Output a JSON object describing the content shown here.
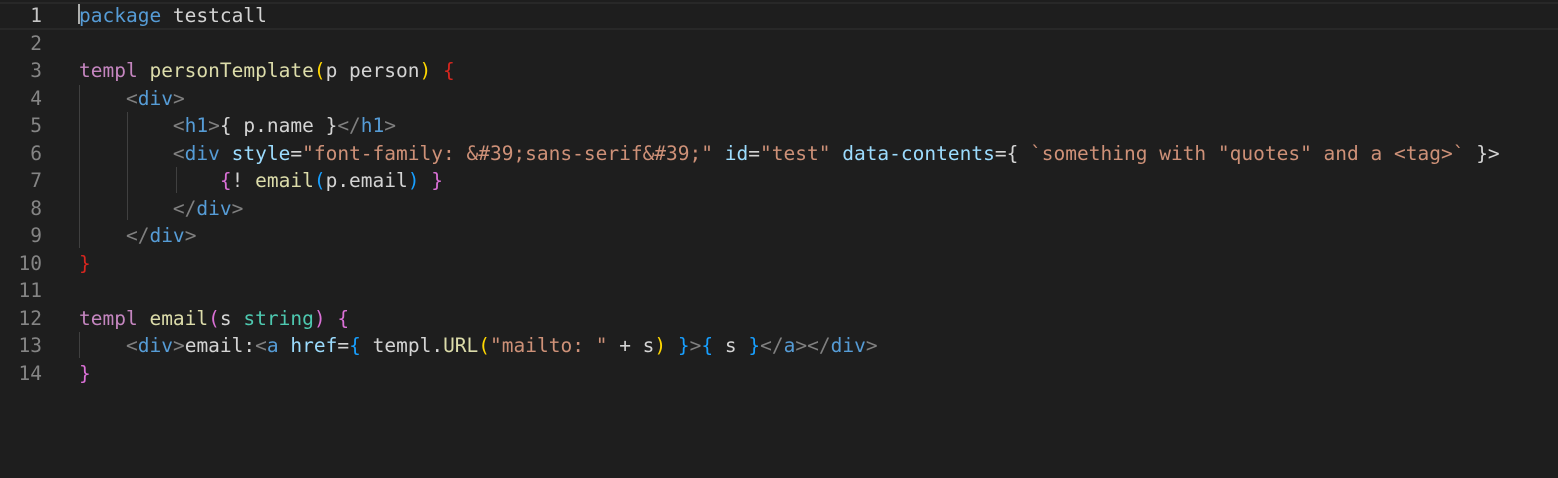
{
  "editor": {
    "line_numbers": [
      "1",
      "2",
      "3",
      "4",
      "5",
      "6",
      "7",
      "8",
      "9",
      "10",
      "11",
      "12",
      "13",
      "14"
    ],
    "lines": [
      [
        {
          "t": "package",
          "c": "kw-blue"
        },
        {
          "t": " testcall",
          "c": "plain"
        }
      ],
      [],
      [
        {
          "t": "templ ",
          "c": "kw-purple"
        },
        {
          "t": "personTemplate",
          "c": "fn"
        },
        {
          "t": "(",
          "c": "b-gold"
        },
        {
          "t": "p person",
          "c": "plain"
        },
        {
          "t": ")",
          "c": "b-gold"
        },
        {
          "t": " ",
          "c": "plain"
        },
        {
          "t": "{",
          "c": "b-red"
        }
      ],
      [
        {
          "t": "    ",
          "c": "plain"
        },
        {
          "t": "<",
          "c": "punct"
        },
        {
          "t": "div",
          "c": "tag"
        },
        {
          "t": ">",
          "c": "punct"
        }
      ],
      [
        {
          "t": "        ",
          "c": "plain"
        },
        {
          "t": "<",
          "c": "punct"
        },
        {
          "t": "h1",
          "c": "tag"
        },
        {
          "t": ">",
          "c": "punct"
        },
        {
          "t": "{ p.name }",
          "c": "plain"
        },
        {
          "t": "</",
          "c": "punct"
        },
        {
          "t": "h1",
          "c": "tag"
        },
        {
          "t": ">",
          "c": "punct"
        }
      ],
      [
        {
          "t": "        ",
          "c": "plain"
        },
        {
          "t": "<",
          "c": "punct"
        },
        {
          "t": "div",
          "c": "tag"
        },
        {
          "t": " ",
          "c": "plain"
        },
        {
          "t": "style",
          "c": "attr"
        },
        {
          "t": "=",
          "c": "plain"
        },
        {
          "t": "\"font-family: &#39;sans-serif&#39;\"",
          "c": "str"
        },
        {
          "t": " ",
          "c": "plain"
        },
        {
          "t": "id",
          "c": "attr"
        },
        {
          "t": "=",
          "c": "plain"
        },
        {
          "t": "\"test\"",
          "c": "str"
        },
        {
          "t": " ",
          "c": "plain"
        },
        {
          "t": "data-contents",
          "c": "attr"
        },
        {
          "t": "={ ",
          "c": "plain"
        },
        {
          "t": "`something with \"quotes\" and a <tag>`",
          "c": "str"
        },
        {
          "t": " }>",
          "c": "plain"
        }
      ],
      [
        {
          "t": "            ",
          "c": "plain"
        },
        {
          "t": "{",
          "c": "b-pink"
        },
        {
          "t": "! ",
          "c": "plain"
        },
        {
          "t": "email",
          "c": "fn"
        },
        {
          "t": "(",
          "c": "b-blue"
        },
        {
          "t": "p.email",
          "c": "plain"
        },
        {
          "t": ")",
          "c": "b-blue"
        },
        {
          "t": " ",
          "c": "plain"
        },
        {
          "t": "}",
          "c": "b-pink"
        }
      ],
      [
        {
          "t": "        ",
          "c": "plain"
        },
        {
          "t": "</",
          "c": "punct"
        },
        {
          "t": "div",
          "c": "tag"
        },
        {
          "t": ">",
          "c": "punct"
        }
      ],
      [
        {
          "t": "    ",
          "c": "plain"
        },
        {
          "t": "</",
          "c": "punct"
        },
        {
          "t": "div",
          "c": "tag"
        },
        {
          "t": ">",
          "c": "punct"
        }
      ],
      [
        {
          "t": "}",
          "c": "b-red"
        }
      ],
      [],
      [
        {
          "t": "templ ",
          "c": "kw-purple"
        },
        {
          "t": "email",
          "c": "fn"
        },
        {
          "t": "(",
          "c": "b-pink"
        },
        {
          "t": "s ",
          "c": "plain"
        },
        {
          "t": "string",
          "c": "type"
        },
        {
          "t": ")",
          "c": "b-pink"
        },
        {
          "t": " ",
          "c": "plain"
        },
        {
          "t": "{",
          "c": "b-pink"
        }
      ],
      [
        {
          "t": "    ",
          "c": "plain"
        },
        {
          "t": "<",
          "c": "punct"
        },
        {
          "t": "div",
          "c": "tag"
        },
        {
          "t": ">",
          "c": "punct"
        },
        {
          "t": "email:",
          "c": "plain"
        },
        {
          "t": "<",
          "c": "punct"
        },
        {
          "t": "a",
          "c": "tag"
        },
        {
          "t": " ",
          "c": "plain"
        },
        {
          "t": "href",
          "c": "attr"
        },
        {
          "t": "=",
          "c": "plain"
        },
        {
          "t": "{",
          "c": "b-blue"
        },
        {
          "t": " templ.",
          "c": "plain"
        },
        {
          "t": "URL",
          "c": "fn"
        },
        {
          "t": "(",
          "c": "b-gold"
        },
        {
          "t": "\"mailto: \"",
          "c": "str"
        },
        {
          "t": " + s",
          "c": "plain"
        },
        {
          "t": ")",
          "c": "b-gold"
        },
        {
          "t": " ",
          "c": "plain"
        },
        {
          "t": "}",
          "c": "b-blue"
        },
        {
          "t": ">",
          "c": "punct"
        },
        {
          "t": "{",
          "c": "b-blue"
        },
        {
          "t": " s ",
          "c": "plain"
        },
        {
          "t": "}",
          "c": "b-blue"
        },
        {
          "t": "</",
          "c": "punct"
        },
        {
          "t": "a",
          "c": "tag"
        },
        {
          "t": "></",
          "c": "punct"
        },
        {
          "t": "div",
          "c": "tag"
        },
        {
          "t": ">",
          "c": "punct"
        }
      ],
      [
        {
          "t": "}",
          "c": "b-pink"
        }
      ]
    ]
  }
}
